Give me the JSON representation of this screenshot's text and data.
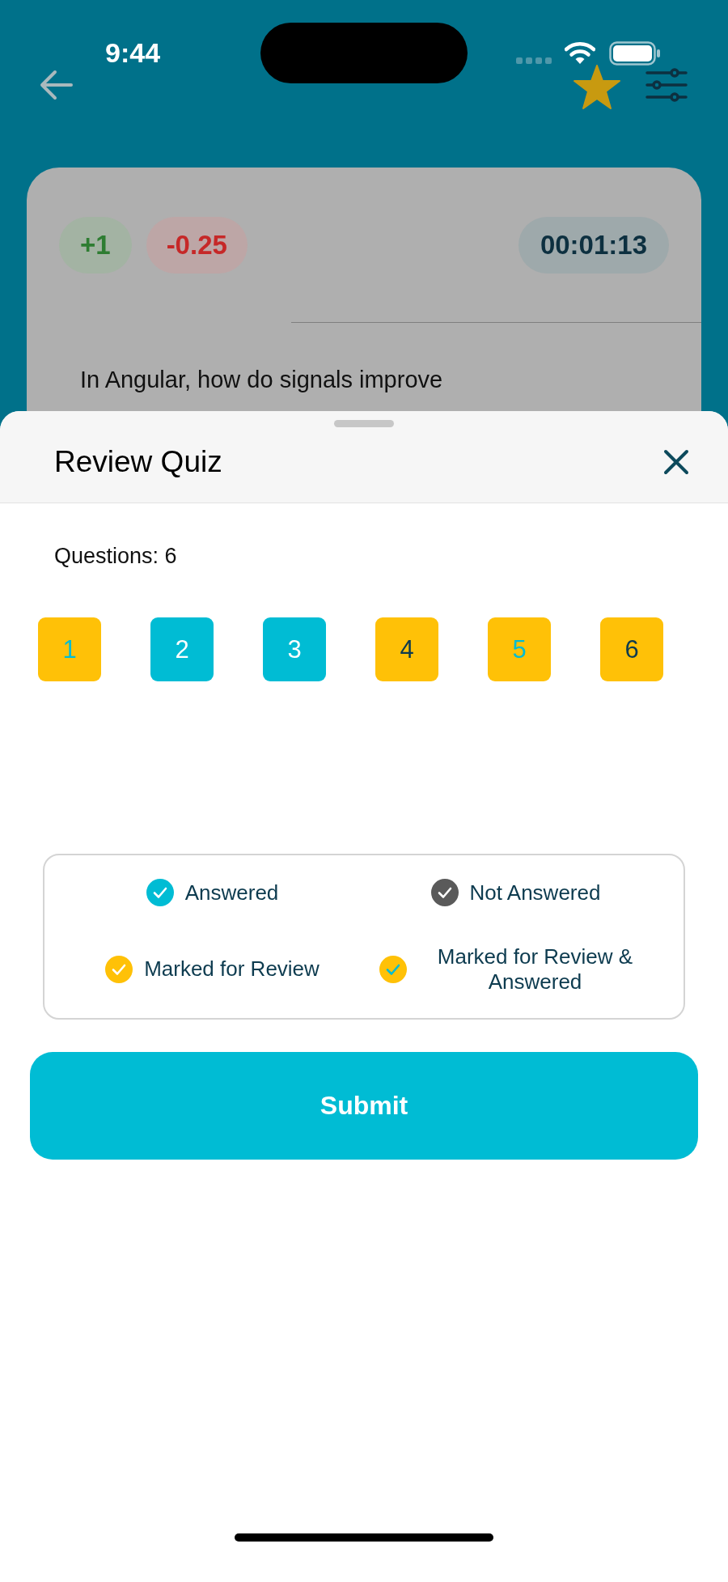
{
  "status_bar": {
    "time": "9:44"
  },
  "header": {
    "favorite": true
  },
  "question_card": {
    "marks_positive": "+1",
    "marks_negative": "-0.25",
    "timer": "00:01:13",
    "question": "In Angular, how do signals improve"
  },
  "sheet": {
    "title": "Review Quiz",
    "questions_label": "Questions: 6",
    "questions": [
      {
        "number": "1",
        "kind": "marked_answered"
      },
      {
        "number": "2",
        "kind": "answered"
      },
      {
        "number": "3",
        "kind": "answered"
      },
      {
        "number": "4",
        "kind": "marked"
      },
      {
        "number": "5",
        "kind": "marked_answered"
      },
      {
        "number": "6",
        "kind": "marked"
      }
    ],
    "legend": [
      {
        "label": "Answered",
        "kind": "answered"
      },
      {
        "label": "Not Answered",
        "kind": "not_answered"
      },
      {
        "label": "Marked for Review",
        "kind": "marked"
      },
      {
        "label": "Marked for Review & Answered",
        "kind": "marked_answered"
      }
    ],
    "submit": "Submit"
  }
}
